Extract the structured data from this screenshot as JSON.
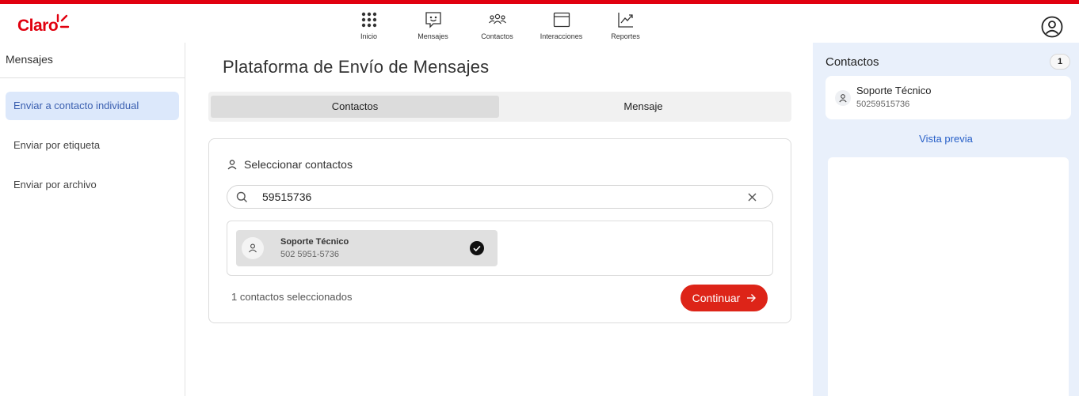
{
  "brand": {
    "logo_text": "Claro",
    "accent_color": "#e1000f",
    "button_color": "#dd2418",
    "link_color": "#2860c8"
  },
  "nav": {
    "items": [
      {
        "label": "Inicio",
        "icon": "grid-icon"
      },
      {
        "label": "Mensajes",
        "icon": "message-smile-icon"
      },
      {
        "label": "Contactos",
        "icon": "people-icon"
      },
      {
        "label": "Interacciones",
        "icon": "window-icon"
      },
      {
        "label": "Reportes",
        "icon": "chart-trend-icon"
      }
    ]
  },
  "sidebar": {
    "title": "Mensajes",
    "items": [
      {
        "label": "Enviar a contacto individual",
        "active": true
      },
      {
        "label": "Enviar por etiqueta",
        "active": false
      },
      {
        "label": "Enviar por archivo",
        "active": false
      }
    ]
  },
  "main": {
    "title": "Plataforma de Envío de Mensajes",
    "tabs": [
      {
        "label": "Contactos",
        "active": true
      },
      {
        "label": "Mensaje",
        "active": false
      }
    ],
    "card": {
      "header": "Seleccionar contactos",
      "search": {
        "value": "59515736"
      },
      "results": [
        {
          "name": "Soporte Técnico",
          "phone": "502 5951-5736",
          "selected": true
        }
      ],
      "selected_count_text": "1 contactos seleccionados",
      "continue_label": "Continuar"
    }
  },
  "right_panel": {
    "title": "Contactos",
    "count": "1",
    "contacts": [
      {
        "name": "Soporte Técnico",
        "phone": "50259515736"
      }
    ],
    "preview_label": "Vista previa"
  }
}
